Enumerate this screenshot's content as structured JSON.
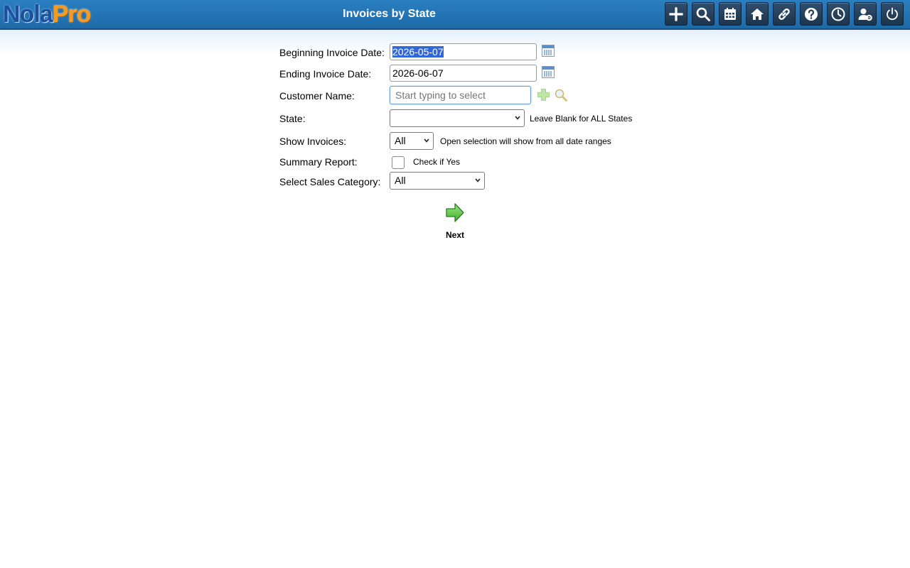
{
  "header": {
    "logo_part1": "Nola",
    "logo_part2": "Pro",
    "title": "Invoices by State",
    "toolbar": [
      {
        "name": "add-icon"
      },
      {
        "name": "search-icon"
      },
      {
        "name": "calendar-icon"
      },
      {
        "name": "home-icon"
      },
      {
        "name": "link-icon"
      },
      {
        "name": "help-icon"
      },
      {
        "name": "clock-icon"
      },
      {
        "name": "user-settings-icon"
      },
      {
        "name": "power-icon"
      }
    ]
  },
  "form": {
    "beginning_date": {
      "label": "Beginning Invoice Date:",
      "value": "2026-05-07"
    },
    "ending_date": {
      "label": "Ending Invoice Date:",
      "value": "2026-06-07"
    },
    "customer": {
      "label": "Customer Name:",
      "placeholder": "Start typing to select"
    },
    "state": {
      "label": "State:",
      "value": "",
      "note": "Leave Blank for ALL States"
    },
    "show_invoices": {
      "label": "Show Invoices:",
      "value": "All",
      "note": "Open selection will show from all date ranges"
    },
    "summary": {
      "label": "Summary Report:",
      "note": "Check if Yes",
      "checked": false
    },
    "sales_category": {
      "label": "Select Sales Category:",
      "value": "All"
    },
    "next_label": "Next"
  },
  "colors": {
    "header_blue": "#2a7fc0",
    "selection": "#3367d6",
    "next_green": "#5cc843"
  }
}
